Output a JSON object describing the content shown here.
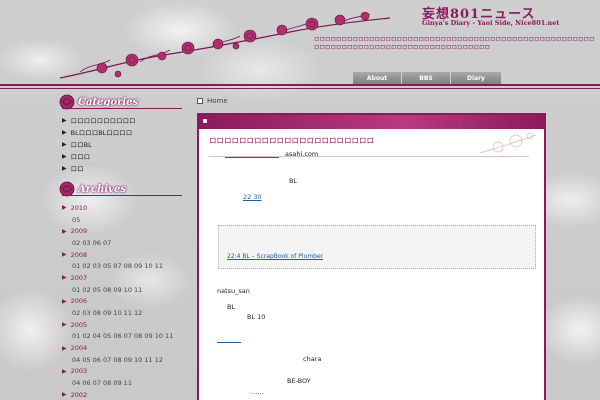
{
  "header": {
    "site_title": "妄想801ニュース",
    "subtitle": "Ginya's Diary - Yaoi Side, Nice801.net",
    "description": "ロロロロロロロロロロロロロロロロロロロロロロロロロロロロロロロロロロロロロロロロロロロロロロロロロロロロロロロロロロロロロロロロロロロロロロロロロロロロロロロロロロロ"
  },
  "nav": {
    "items": [
      "About",
      "BBS",
      "Diary"
    ]
  },
  "sidebar": {
    "categories_heading": "Categories",
    "categories": [
      "ロロロロロロロロロロ",
      "BLロロロBLロロロロ",
      "ロロBL",
      "ロロロ",
      "ロロ"
    ],
    "archives_heading": "Archives",
    "archives": [
      {
        "year": "2010",
        "months": "05"
      },
      {
        "year": "2009",
        "months": "02 03 06 07"
      },
      {
        "year": "2008",
        "months": "01 02 03 05 07 08 09 10 11"
      },
      {
        "year": "2007",
        "months": "01 02 05 08 09 10 11"
      },
      {
        "year": "2006",
        "months": "02 03 08 09 10 11 12"
      },
      {
        "year": "2005",
        "months": "01 02 04 05 06 07 08 09 10 11"
      },
      {
        "year": "2004",
        "months": "04 05 06 07 08 09 10 11 12"
      },
      {
        "year": "2003",
        "months": "04 06 07 08 09 11"
      },
      {
        "year": "2002",
        "months": ""
      }
    ]
  },
  "breadcrumb": {
    "home": "Home"
  },
  "post": {
    "title": "ロロロロロロロロロロロロロロロロロロロロロロ",
    "source": "asahi.com",
    "line1": "BL",
    "link1": "22 30",
    "quote_link": "22:4  BL  –  ScrapBook of Plumber",
    "author": "natsu_san",
    "line2": "BL",
    "line3": "BL  10",
    "chara": "chara",
    "beboy": "BE-BOY",
    "ellipsis": "……"
  },
  "colors": {
    "accent": "#8b1a5c",
    "link": "#1a5fa0"
  }
}
